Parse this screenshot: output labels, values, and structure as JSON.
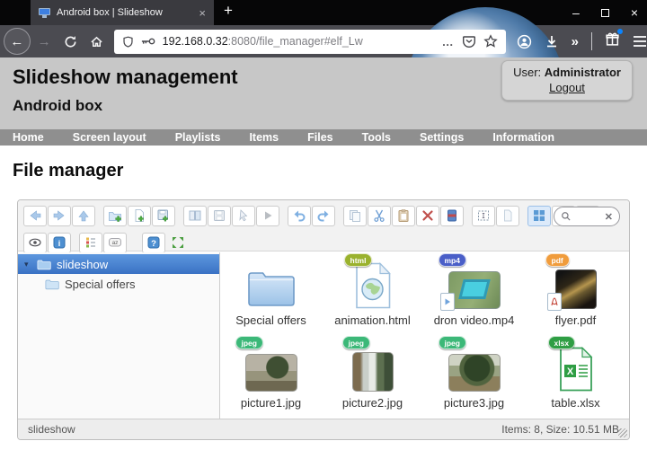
{
  "browser": {
    "tab_title": "Android box | Slideshow",
    "tab_close": "×",
    "new_tab": "+",
    "minimize": "–",
    "close": "×",
    "back_arrow": "←",
    "forward_arrow": "→",
    "url_host": "192.168.0.32",
    "url_rest": ":8080/file_manager#elf_Lw",
    "page_actions_dots": "…",
    "overflow_chevron": "»"
  },
  "header": {
    "title": "Slideshow management",
    "subtitle": "Android box",
    "user_label": "User:",
    "user_name": "Administrator",
    "logout_label": "Logout"
  },
  "nav": {
    "items": [
      "Home",
      "Screen layout",
      "Playlists",
      "Items",
      "Files",
      "Tools",
      "Settings",
      "Information"
    ]
  },
  "page": {
    "heading": "File manager"
  },
  "filemanager": {
    "toolbar_row1": [
      "back",
      "forward",
      "up",
      "new-folder",
      "new-file",
      "upload",
      "open",
      "save",
      "pointer",
      "preview",
      "undo",
      "redo",
      "copy",
      "cut",
      "paste",
      "delete",
      "archive",
      "select-all",
      "select-none",
      "view-grid",
      "view-list",
      "view-compact"
    ],
    "toolbar_row2": [
      "toggle-hidden",
      "info",
      "sort",
      "sort-name",
      "help",
      "fullscreen"
    ],
    "icons": {
      "info": "i",
      "help": "?",
      "sort_az": "az",
      "xlsx_letter": "X"
    },
    "tree": [
      {
        "label": "slideshow",
        "selected": true,
        "caret": "▾"
      },
      {
        "label": "Special offers",
        "selected": false
      }
    ],
    "files": [
      {
        "name": "Special offers",
        "type": "folder"
      },
      {
        "name": "animation.html",
        "type": "html",
        "badge": "html"
      },
      {
        "name": "dron video.mp4",
        "type": "video",
        "badge": "mp4"
      },
      {
        "name": "flyer.pdf",
        "type": "pdf",
        "badge": "pdf"
      },
      {
        "name": "picture1.jpg",
        "type": "image",
        "badge": "jpeg"
      },
      {
        "name": "picture2.jpg",
        "type": "image",
        "badge": "jpeg"
      },
      {
        "name": "picture3.jpg",
        "type": "image",
        "badge": "jpeg"
      },
      {
        "name": "table.xlsx",
        "type": "xlsx",
        "badge": "xlsx"
      }
    ],
    "status_left": "slideshow",
    "status_right": "Items: 8, Size: 10.51 MB"
  },
  "colors": {
    "tree_selected": "#3f7fd0",
    "nav_bg": "#8f8f8f",
    "header_bg": "#c7c7c7",
    "badge_html": "#9ab22e",
    "badge_mp4": "#4a5fc8",
    "badge_pdf": "#f09c3c",
    "badge_jpeg": "#3cb878",
    "badge_xlsx": "#2f9e44",
    "notification_dot": "#0a84ff"
  }
}
